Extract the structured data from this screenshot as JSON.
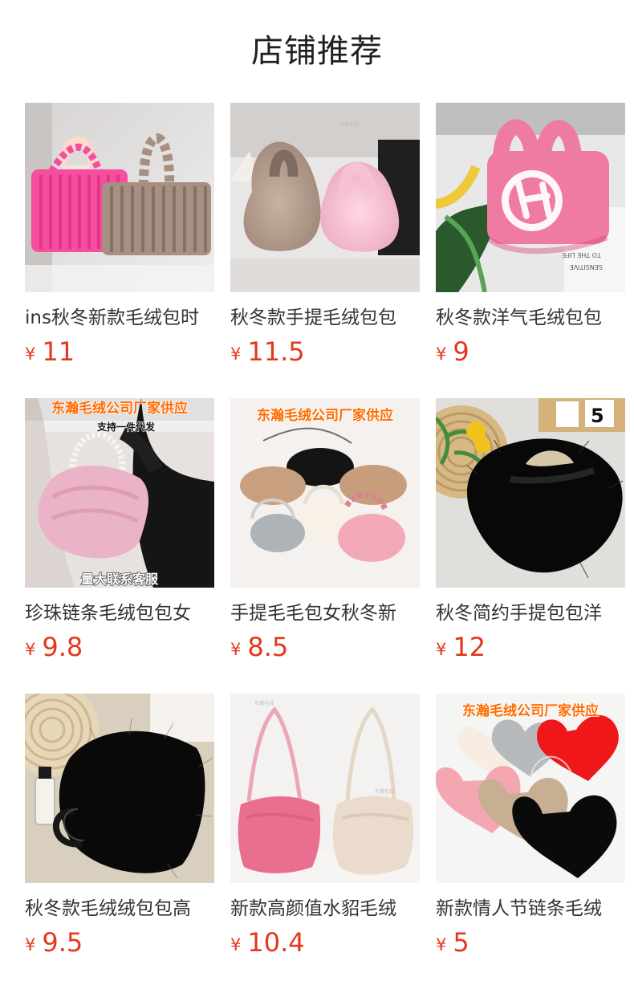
{
  "page": {
    "title": "店铺推荐",
    "price_color": "#e4381c"
  },
  "products": [
    {
      "title": "ins秋冬新款毛绒包时",
      "currency": "¥",
      "price": "11",
      "image": {
        "scene": "pink-taupe-fur-totes",
        "colors": [
          "#f64d9e",
          "#a78f82"
        ],
        "banner": ""
      }
    },
    {
      "title": "秋冬款手提毛绒包包",
      "currency": "¥",
      "price": "11.5",
      "image": {
        "scene": "fluffy-bucket-bags",
        "colors": [
          "#b69d8d",
          "#f4b6c9"
        ],
        "banner": ""
      }
    },
    {
      "title": "秋冬款洋气毛绒包包",
      "currency": "¥",
      "price": "9",
      "image": {
        "scene": "pink-h-logo-fur-bag",
        "colors": [
          "#ef7aa2",
          "#ffffff"
        ],
        "banner": ""
      }
    },
    {
      "title": "珍珠链条毛绒包包女",
      "currency": "¥",
      "price": "9.8",
      "image": {
        "scene": "pearl-chain-pink-bag",
        "colors": [
          "#eab3c8",
          "#151515"
        ],
        "banner": "东瀚毛绒公司厂家供应",
        "subtitle": "支持一件代发",
        "bottom_banner": "量大联系客服"
      }
    },
    {
      "title": "手提毛毛包女秋冬新",
      "currency": "¥",
      "price": "8.5",
      "image": {
        "scene": "six-bag-variants",
        "colors": [
          "#141414",
          "#c9a07f",
          "#f7f1e7",
          "#aeb3b8",
          "#f3aab8"
        ],
        "banner": "东瀚毛绒公司厂家供应"
      }
    },
    {
      "title": "秋冬简约手提包包洋",
      "currency": "¥",
      "price": "12",
      "image": {
        "scene": "black-fur-loop-bag",
        "colors": [
          "#080808",
          "#d6b884"
        ],
        "banner": ""
      }
    },
    {
      "title": "秋冬款毛绒绒包包高",
      "currency": "¥",
      "price": "9.5",
      "image": {
        "scene": "black-fluffy-handbag",
        "colors": [
          "#090909",
          "#d7cdb9"
        ],
        "banner": ""
      }
    },
    {
      "title": "新款高颜值水貂毛绒",
      "currency": "¥",
      "price": "10.4",
      "image": {
        "scene": "pink-cream-mink-totes",
        "colors": [
          "#ea6e8f",
          "#eadbcc"
        ],
        "banner": ""
      }
    },
    {
      "title": "新款情人节链条毛绒",
      "currency": "¥",
      "price": "5",
      "image": {
        "scene": "heart-shaped-bags",
        "colors": [
          "#ef1719",
          "#f4a6b1",
          "#c8ae93",
          "#0a0a0a",
          "#b7babd"
        ],
        "banner": "东瀚毛绒公司厂家供应"
      }
    }
  ]
}
